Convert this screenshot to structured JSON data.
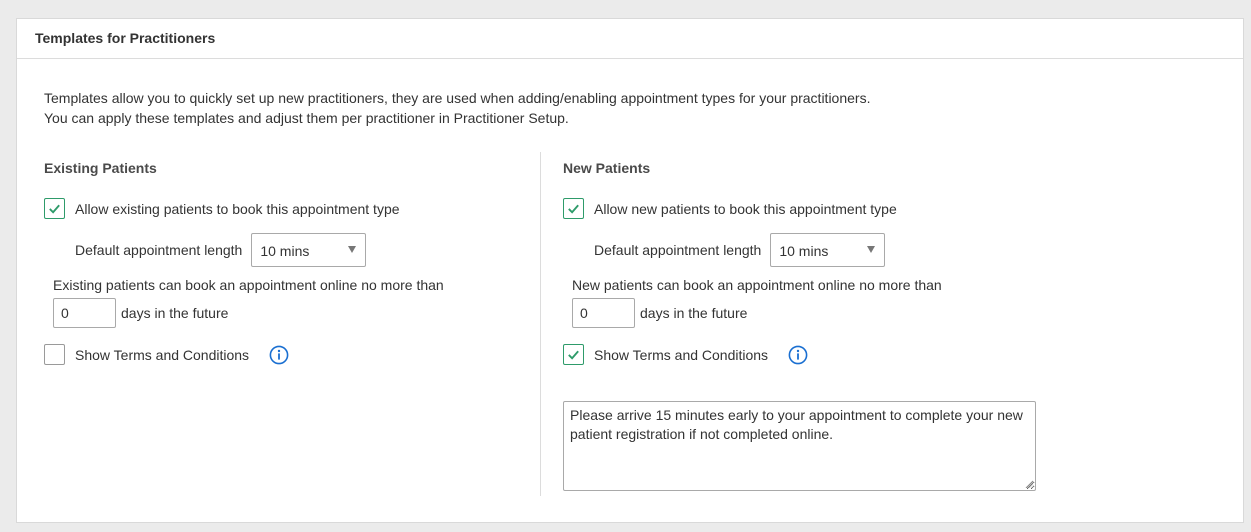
{
  "panel": {
    "title": "Templates for Practitioners",
    "intro_line1": "Templates allow you to quickly set up new practitioners, they are used when adding/enabling appointment types for your practitioners.",
    "intro_line2": "You can apply these templates and adjust them per practitioner in Practitioner Setup."
  },
  "existing": {
    "title": "Existing Patients",
    "allow_label": "Allow existing patients to book this appointment type",
    "allow_checked": true,
    "length_label": "Default appointment length",
    "length_value": "10 mins",
    "limit_label": "Existing patients can book an appointment online no more than",
    "days_value": "0",
    "days_suffix": "days in the future",
    "terms_label": "Show Terms and Conditions",
    "terms_checked": false
  },
  "new": {
    "title": "New Patients",
    "allow_label": "Allow new patients to book this appointment type",
    "allow_checked": true,
    "length_label": "Default appointment length",
    "length_value": "10 mins",
    "limit_label": "New patients can book an appointment online no more than",
    "days_value": "0",
    "days_suffix": "days in the future",
    "terms_label": "Show Terms and Conditions",
    "terms_checked": true,
    "terms_text": "Please arrive 15 minutes early to your appointment to complete your new patient registration if not completed online."
  },
  "colors": {
    "check_green": "#2e9b6a",
    "info_blue": "#1a6fd1"
  },
  "icons": {
    "checkmark": "checkmark-icon",
    "info": "info-icon",
    "dropdown": "caret-down-icon"
  }
}
